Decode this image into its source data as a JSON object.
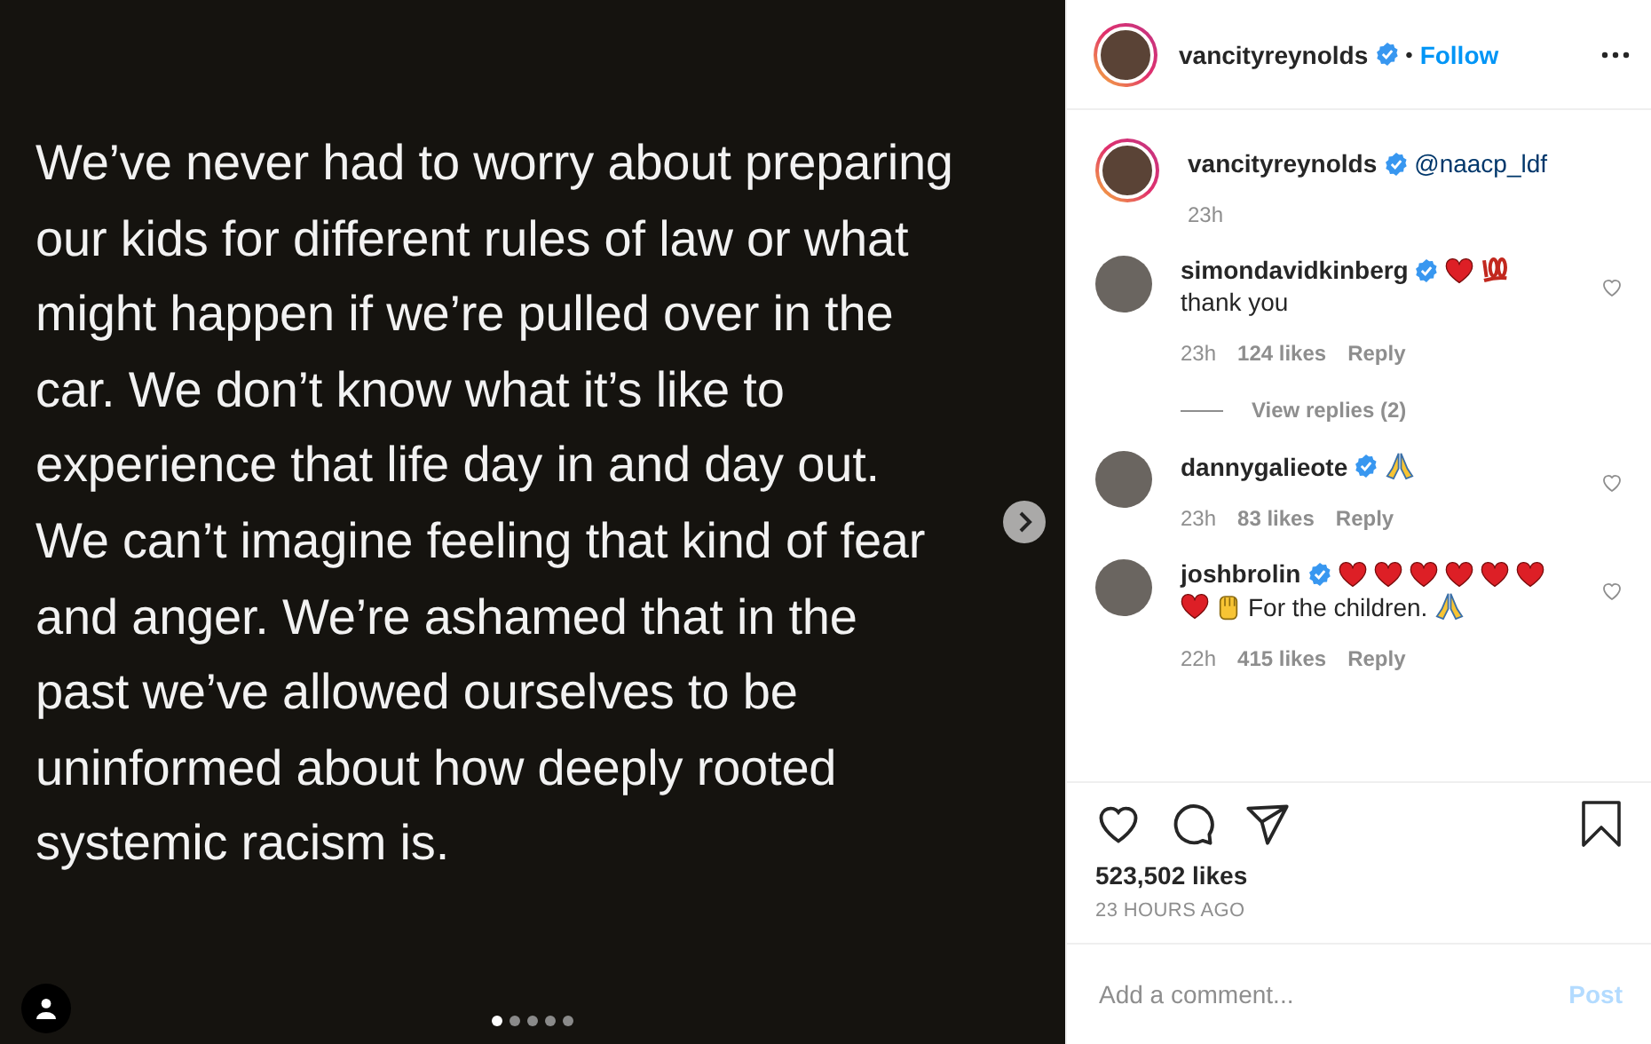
{
  "media": {
    "text": "We’ve never had to worry about preparing\nour kids for different rules of law or what\nmight happen if we’re pulled over in the\ncar. We don’t know what it’s like to\nexperience that life day in and day out.\nWe can’t imagine feeling that kind of fear\nand anger. We’re ashamed that in the\npast we’ve allowed ourselves to be\nuninformed about how deeply rooted\nsystemic racism is.",
    "dots": [
      {
        "selected": true
      },
      {
        "selected": false
      },
      {
        "selected": false
      },
      {
        "selected": false
      },
      {
        "selected": false
      }
    ]
  },
  "header": {
    "username": "vancityreynolds",
    "verified": true,
    "separator": "•",
    "follow": "Follow"
  },
  "caption": {
    "username": "vancityreynolds",
    "verified": true,
    "mention": "@naacp_ldf",
    "time": "23h"
  },
  "comments": [
    {
      "username": "simondavidkinberg",
      "verified": true,
      "parts": [
        {
          "kind": "heart"
        },
        {
          "kind": "hundred"
        },
        {
          "kind": "break"
        },
        {
          "kind": "text",
          "text": "thank you"
        }
      ],
      "time": "23h",
      "likes": "124 likes",
      "reply": "Reply",
      "liked": false,
      "view_replies": "View replies (2)"
    },
    {
      "username": "dannygalieote",
      "verified": true,
      "parts": [
        {
          "kind": "pray"
        }
      ],
      "time": "23h",
      "likes": "83 likes",
      "reply": "Reply",
      "liked": false
    },
    {
      "username": "joshbrolin",
      "verified": true,
      "parts": [
        {
          "kind": "heart"
        },
        {
          "kind": "heart"
        },
        {
          "kind": "heart"
        },
        {
          "kind": "heart"
        },
        {
          "kind": "heart"
        },
        {
          "kind": "heart"
        },
        {
          "kind": "break"
        },
        {
          "kind": "heart"
        },
        {
          "kind": "fist"
        },
        {
          "kind": "text",
          "text": "For the children."
        },
        {
          "kind": "pray"
        }
      ],
      "time": "22h",
      "likes": "415 likes",
      "reply": "Reply",
      "liked": false
    }
  ],
  "actions": {
    "liked": false,
    "saved": false,
    "likes": "523,502 likes",
    "time": "23 HOURS AGO"
  },
  "add_comment": {
    "placeholder": "Add a comment...",
    "post": "Post"
  }
}
